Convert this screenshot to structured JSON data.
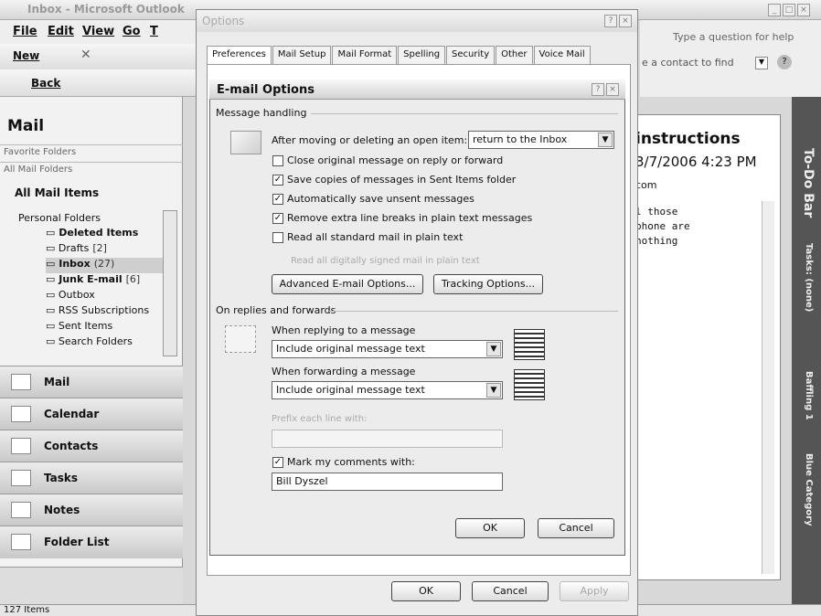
{
  "app": {
    "title": "Inbox - Microsoft Outlook",
    "help_placeholder": "Type a question for help",
    "menus": [
      "File",
      "Edit",
      "View",
      "Go",
      "T"
    ],
    "toolbar": {
      "new_label": "New",
      "back_label": "Back",
      "find_contact_placeholder": "e a contact to find"
    }
  },
  "nav": {
    "header": "Mail",
    "favorite_folders": "Favorite Folders",
    "all_mail_folders": "All Mail Folders",
    "all_mail_items": "All Mail Items",
    "personal_folders": "Personal Folders",
    "folders": [
      {
        "label": "Deleted Items",
        "count": "",
        "bold": true
      },
      {
        "label": "Drafts",
        "count": "[2]",
        "bold": false
      },
      {
        "label": "Inbox",
        "count": "(27)",
        "bold": true
      },
      {
        "label": "Junk E-mail",
        "count": "[6]",
        "bold": true
      },
      {
        "label": "Outbox",
        "count": "",
        "bold": false
      },
      {
        "label": "RSS Subscriptions",
        "count": "",
        "bold": false
      },
      {
        "label": "Sent Items",
        "count": "",
        "bold": false
      },
      {
        "label": "Search Folders",
        "count": "",
        "bold": false
      }
    ],
    "buttons": [
      "Mail",
      "Calendar",
      "Contacts",
      "Tasks",
      "Notes",
      "Folder List"
    ]
  },
  "reading": {
    "subject": "instructions",
    "date": "3/7/2006 4:23 PM",
    "from": "com",
    "body": [
      "l those",
      "phone are",
      "nothing"
    ]
  },
  "todo": {
    "title": "To-Do Bar",
    "tasks": "Tasks: (none)",
    "item1": "Baffling 1",
    "item2": "Blue Category"
  },
  "status": "127 Items",
  "options": {
    "title": "Options",
    "tabs": [
      "Preferences",
      "Mail Setup",
      "Mail Format",
      "Spelling",
      "Security",
      "Other",
      "Voice Mail"
    ],
    "ok": "OK",
    "cancel": "Cancel",
    "apply": "Apply"
  },
  "email_options": {
    "title": "E-mail Options",
    "message_handling": "Message handling",
    "after_moving_label": "After moving or deleting an open item:",
    "after_moving_value": "return to the Inbox",
    "checkboxes": [
      {
        "label": "Close original message on reply or forward",
        "checked": false
      },
      {
        "label": "Save copies of messages in Sent Items folder",
        "checked": true
      },
      {
        "label": "Automatically save unsent messages",
        "checked": true
      },
      {
        "label": "Remove extra line breaks in plain text messages",
        "checked": true
      },
      {
        "label": "Read all standard mail in plain text",
        "checked": false
      }
    ],
    "read_signed": "Read all digitally signed mail in plain text",
    "advanced_btn": "Advanced E-mail Options...",
    "tracking_btn": "Tracking Options...",
    "replies_forwards": "On replies and forwards",
    "when_replying": "When replying to a message",
    "replying_value": "Include original message text",
    "when_forwarding": "When forwarding a message",
    "forwarding_value": "Include original message text",
    "prefix_label": "Prefix each line with:",
    "mark_comments": "Mark my comments with:",
    "mark_checked": true,
    "comment_name": "Bill Dyszel",
    "ok": "OK",
    "cancel": "Cancel"
  }
}
